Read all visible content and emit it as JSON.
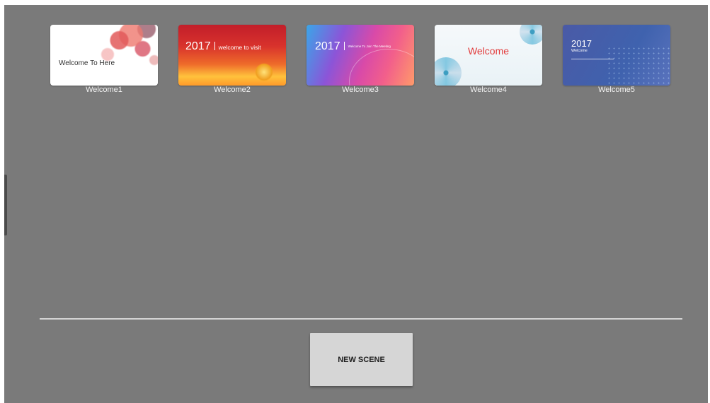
{
  "scenes": [
    {
      "label": "Welcome1",
      "thumb_text": "Welcome To Here"
    },
    {
      "label": "Welcome2",
      "thumb_year": "2017",
      "thumb_text": "welcome to visit"
    },
    {
      "label": "Welcome3",
      "thumb_year": "2017",
      "thumb_text": "Welcome To Join The Meeting"
    },
    {
      "label": "Welcome4",
      "thumb_text": "Welcome"
    },
    {
      "label": "Welcome5",
      "thumb_year": "2017",
      "thumb_text": "Welcome"
    }
  ],
  "actions": {
    "new_scene_label": "NEW SCENE"
  },
  "colors": {
    "background": "#7a7a7a",
    "button": "#d6d6d6",
    "divider": "#d4d4d4",
    "welcome4_text": "#e23b3b"
  }
}
